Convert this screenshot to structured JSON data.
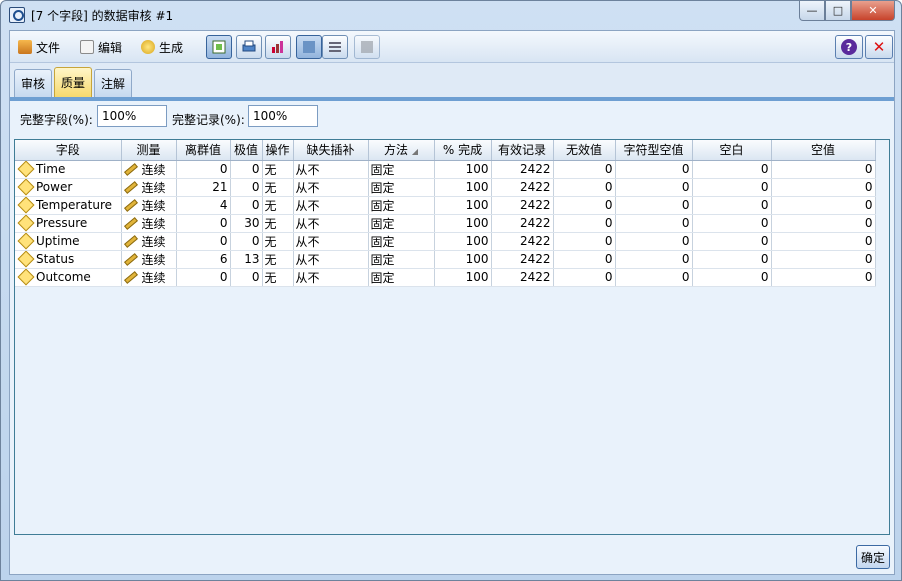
{
  "window": {
    "title": "[7 个字段] 的数据审核 #1",
    "caption": {
      "minimize": "—",
      "maximize": "□",
      "close": "✕"
    }
  },
  "menu": [
    {
      "label": "文件",
      "icon": "file-icon"
    },
    {
      "label": "编辑",
      "icon": "edit-icon"
    },
    {
      "label": "生成",
      "icon": "generate-icon"
    }
  ],
  "toolbar_icons": [
    "copy-icon",
    "print-icon",
    "chart-icon",
    "grid-view-icon",
    "list-view-icon",
    "table-view-icon"
  ],
  "help": {
    "help_icon": "?",
    "close_icon": "✕"
  },
  "tabs": [
    {
      "label": "审核"
    },
    {
      "label": "质量"
    },
    {
      "label": "注解"
    }
  ],
  "quality": {
    "complete_fields_label": "完整字段(%):",
    "complete_fields_value": "100%",
    "complete_records_label": "完整记录(%):",
    "complete_records_value": "100%"
  },
  "table": {
    "columns": [
      "字段",
      "测量",
      "离群值",
      "极值",
      "操作",
      "缺失插补",
      "方法",
      "% 完成",
      "有效记录",
      "无效值",
      "字符型空值",
      "空白",
      "空值"
    ],
    "sort_indicator": "◢",
    "rows": [
      {
        "field": "Time",
        "measure": "连续",
        "outliers": "0",
        "extremes": "0",
        "action": "无",
        "impute": "从不",
        "method": "固定",
        "complete": "100",
        "valid": "2422",
        "invalid": "0",
        "string_null": "0",
        "blank": "0",
        "null": "0"
      },
      {
        "field": "Power",
        "measure": "连续",
        "outliers": "21",
        "extremes": "0",
        "action": "无",
        "impute": "从不",
        "method": "固定",
        "complete": "100",
        "valid": "2422",
        "invalid": "0",
        "string_null": "0",
        "blank": "0",
        "null": "0"
      },
      {
        "field": "Temperature",
        "measure": "连续",
        "outliers": "4",
        "extremes": "0",
        "action": "无",
        "impute": "从不",
        "method": "固定",
        "complete": "100",
        "valid": "2422",
        "invalid": "0",
        "string_null": "0",
        "blank": "0",
        "null": "0"
      },
      {
        "field": "Pressure",
        "measure": "连续",
        "outliers": "0",
        "extremes": "30",
        "action": "无",
        "impute": "从不",
        "method": "固定",
        "complete": "100",
        "valid": "2422",
        "invalid": "0",
        "string_null": "0",
        "blank": "0",
        "null": "0"
      },
      {
        "field": "Uptime",
        "measure": "连续",
        "outliers": "0",
        "extremes": "0",
        "action": "无",
        "impute": "从不",
        "method": "固定",
        "complete": "100",
        "valid": "2422",
        "invalid": "0",
        "string_null": "0",
        "blank": "0",
        "null": "0"
      },
      {
        "field": "Status",
        "measure": "连续",
        "outliers": "6",
        "extremes": "13",
        "action": "无",
        "impute": "从不",
        "method": "固定",
        "complete": "100",
        "valid": "2422",
        "invalid": "0",
        "string_null": "0",
        "blank": "0",
        "null": "0"
      },
      {
        "field": "Outcome",
        "measure": "连续",
        "outliers": "0",
        "extremes": "0",
        "action": "无",
        "impute": "从不",
        "method": "固定",
        "complete": "100",
        "valid": "2422",
        "invalid": "0",
        "string_null": "0",
        "blank": "0",
        "null": "0"
      }
    ]
  },
  "ok_button": "确定"
}
